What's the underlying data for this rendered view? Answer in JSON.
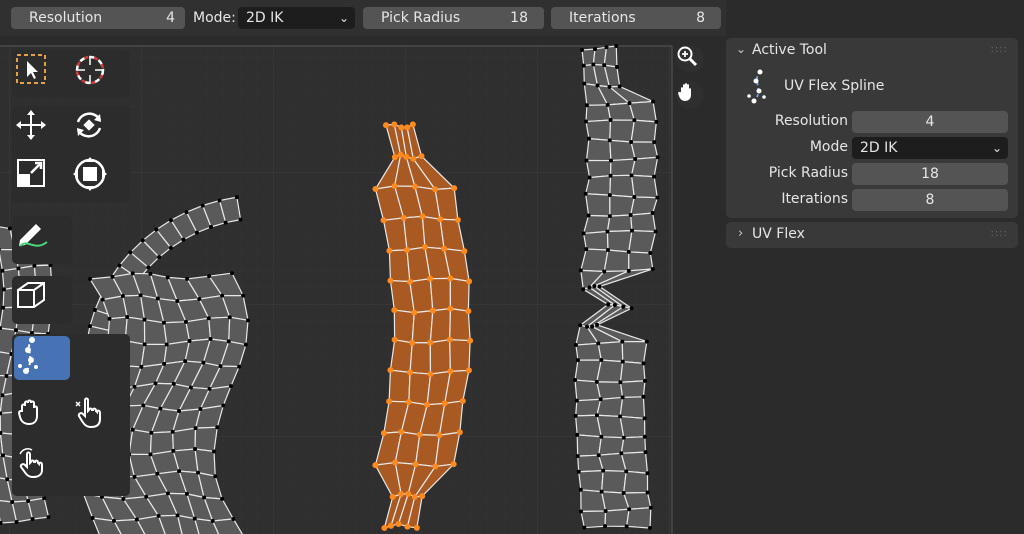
{
  "header": {
    "resolution": {
      "label": "Resolution",
      "value": "4"
    },
    "mode": {
      "label": "Mode:",
      "value": "2D IK"
    },
    "pick_radius": {
      "label": "Pick Radius",
      "value": "18"
    },
    "iterations": {
      "label": "Iterations",
      "value": "8"
    }
  },
  "toolbar": {
    "tools": [
      {
        "name": "select-box-tool"
      },
      {
        "name": "cursor-tool"
      },
      {
        "name": "move-tool"
      },
      {
        "name": "rotate-tool"
      },
      {
        "name": "scale-tool"
      },
      {
        "name": "transform-tool"
      },
      {
        "name": "annotate-tool"
      },
      {
        "name": "box-project-tool"
      },
      {
        "name": "uv-flex-spline-tool",
        "active": true
      },
      {
        "name": "grab-tool"
      },
      {
        "name": "relax-tool"
      },
      {
        "name": "pinch-tool"
      }
    ],
    "active_color": "#4772b3"
  },
  "navigation": {
    "zoom_icon": "zoom-icon",
    "pan_icon": "hand-pan-icon"
  },
  "panel": {
    "active_tool": {
      "title": "Active Tool",
      "tool_name": "UV Flex Spline",
      "props": {
        "resolution": {
          "label": "Resolution",
          "value": "4"
        },
        "mode": {
          "label": "Mode",
          "value": "2D IK"
        },
        "pick_radius": {
          "label": "Pick Radius",
          "value": "18"
        },
        "iterations": {
          "label": "Iterations",
          "value": "8"
        }
      }
    },
    "uv_flex": {
      "title": "UV Flex"
    }
  },
  "colors": {
    "selected_face": "#a85a22",
    "selected_vertex": "#ff8a1f",
    "unselected_face": "#5a5a5a",
    "unselected_vertex": "#000000",
    "edge": "#e8e8e8"
  }
}
